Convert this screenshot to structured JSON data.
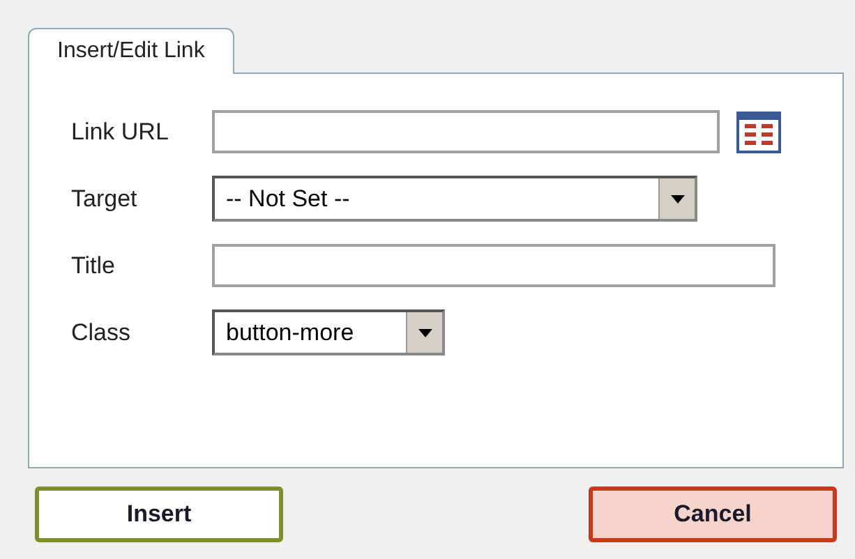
{
  "tabs": [
    {
      "label": "Insert/Edit Link",
      "selected": true
    }
  ],
  "fields": [
    {
      "kind": "text",
      "label": "Link URL",
      "browse": true
    },
    {
      "kind": "select",
      "label": "Target",
      "value": "-- Not Set --"
    },
    {
      "kind": "text",
      "label": "Title",
      "browse": false
    },
    {
      "kind": "select",
      "label": "Class",
      "value": "button-more"
    }
  ],
  "buttons": [
    {
      "label": "Insert",
      "kind": "primary"
    },
    {
      "label": "Cancel",
      "kind": "cancel"
    }
  ]
}
